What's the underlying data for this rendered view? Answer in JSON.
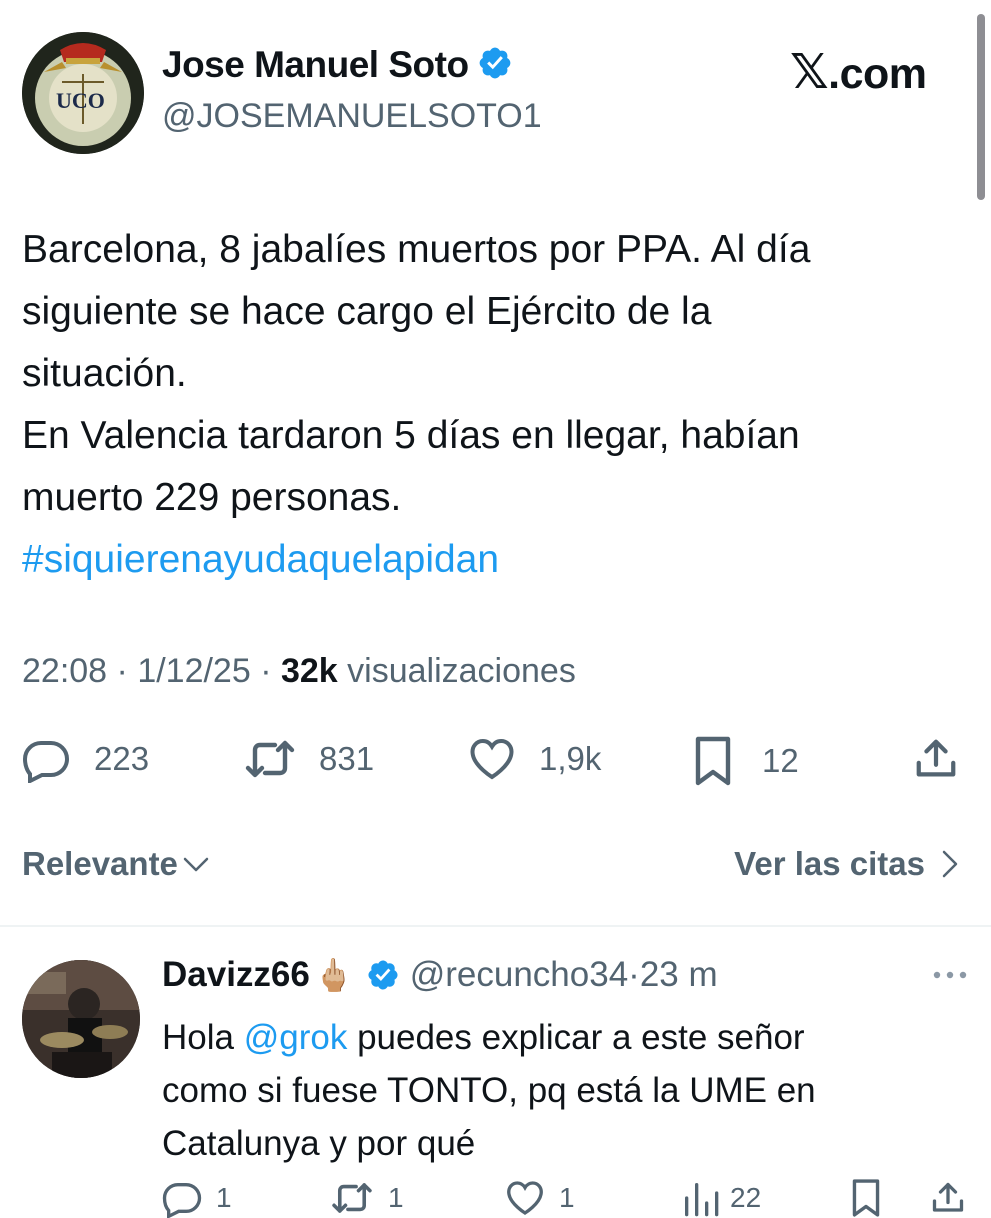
{
  "author": {
    "name": "Jose Manuel Soto",
    "handle": "@JOSEMANUELSOTO1",
    "avatar_text": "UCO"
  },
  "brand": {
    "logo": "𝕏",
    "domain": ".com"
  },
  "tweet": {
    "lines": [
      "Barcelona, 8 jabalíes muertos por PPA. Al día",
      "siguiente se hace cargo el Ejército de la",
      "situación.",
      "En Valencia tardaron 5 días en llegar, habían",
      "muerto 229 personas."
    ],
    "hashtag": "#siquierenayudaquelapidan"
  },
  "meta": {
    "time": "22:08",
    "sep1": " · ",
    "date": "1/12/25",
    "sep2": " · ",
    "views_count": "32k",
    "views_label": " visualizaciones"
  },
  "actions": {
    "replies": "223",
    "reposts": "831",
    "likes": "1,9k",
    "bookmarks": "12"
  },
  "sort": {
    "label": "Relevante"
  },
  "quotes": {
    "label": "Ver las citas"
  },
  "reply": {
    "name": "Davizz66",
    "emoji": "🖕🏼",
    "handle": "@recuncho34",
    "sep": " · ",
    "time": "23 m",
    "text_before_mention": "Hola ",
    "mention": "@grok",
    "text_after_mention": " puedes explicar a este señor",
    "line2": "como si fuese TONTO, pq está la UME en",
    "line3": "Catalunya y por qué",
    "counts": {
      "replies": "1",
      "reposts": "1",
      "likes": "1",
      "views": "22"
    }
  },
  "colors": {
    "accent": "#1d9bf0",
    "text": "#0f1419",
    "secondary": "#536471"
  }
}
